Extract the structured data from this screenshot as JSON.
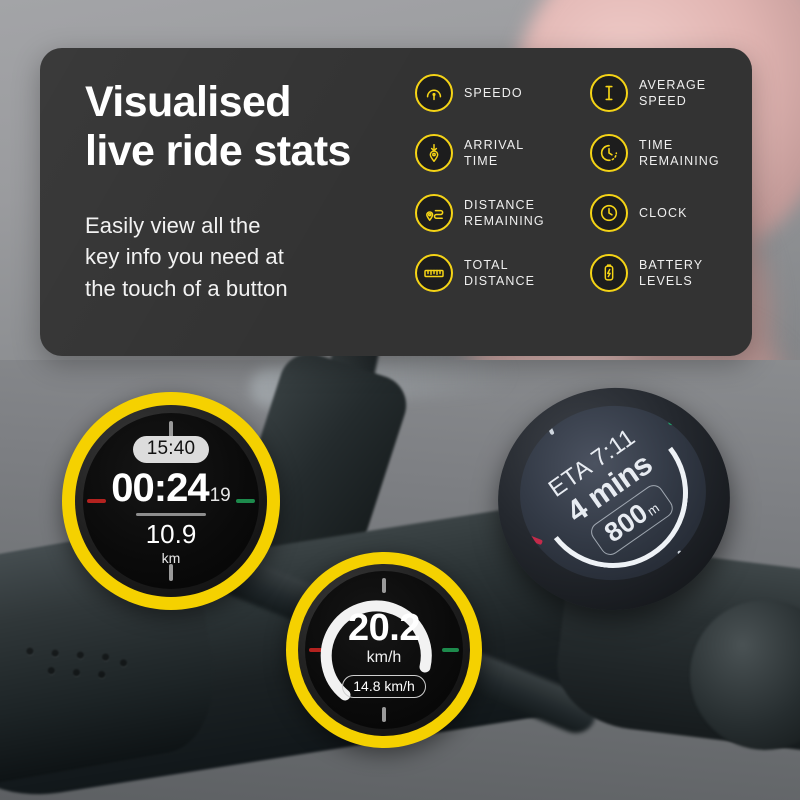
{
  "panel": {
    "headline": "Visualised\nlive ride stats",
    "subcopy": "Easily view all the\nkey info you need at\nthe touch of a button",
    "background": "#333333",
    "accent": "#f5d416"
  },
  "features": [
    {
      "icon": "speedo-gauge-icon",
      "label": "SPEEDO"
    },
    {
      "icon": "average-speed-icon",
      "label": "AVERAGE\nSPEED"
    },
    {
      "icon": "arrival-time-pin-icon",
      "label": "ARRIVAL\nTIME"
    },
    {
      "icon": "time-remaining-icon",
      "label": "TIME\nREMAINING"
    },
    {
      "icon": "distance-remaining-icon",
      "label": "DISTANCE\nREMAINING"
    },
    {
      "icon": "clock-icon",
      "label": "CLOCK"
    },
    {
      "icon": "total-distance-ruler-icon",
      "label": "TOTAL\nDISTANCE"
    },
    {
      "icon": "battery-levels-icon",
      "label": "BATTERY\nLEVELS"
    }
  ],
  "devices": {
    "ride_timer": {
      "clock_pill": "15:40",
      "elapsed": "00:24",
      "elapsed_fraction": "19",
      "distance_value": "10.9",
      "distance_unit": "km",
      "ring_color": "#f5d100",
      "tick_left_color": "#b3221f",
      "tick_right_color": "#1d8a4c"
    },
    "speedometer": {
      "speed_value": "20.2",
      "speed_unit": "km/h",
      "average_pill": "14.8 km/h",
      "ring_color": "#f5d100",
      "arc_percent": 62
    },
    "navigation": {
      "eta_label": "ETA 7:11",
      "time_remaining": "4 mins",
      "distance_value": "800",
      "distance_unit": "m"
    }
  }
}
